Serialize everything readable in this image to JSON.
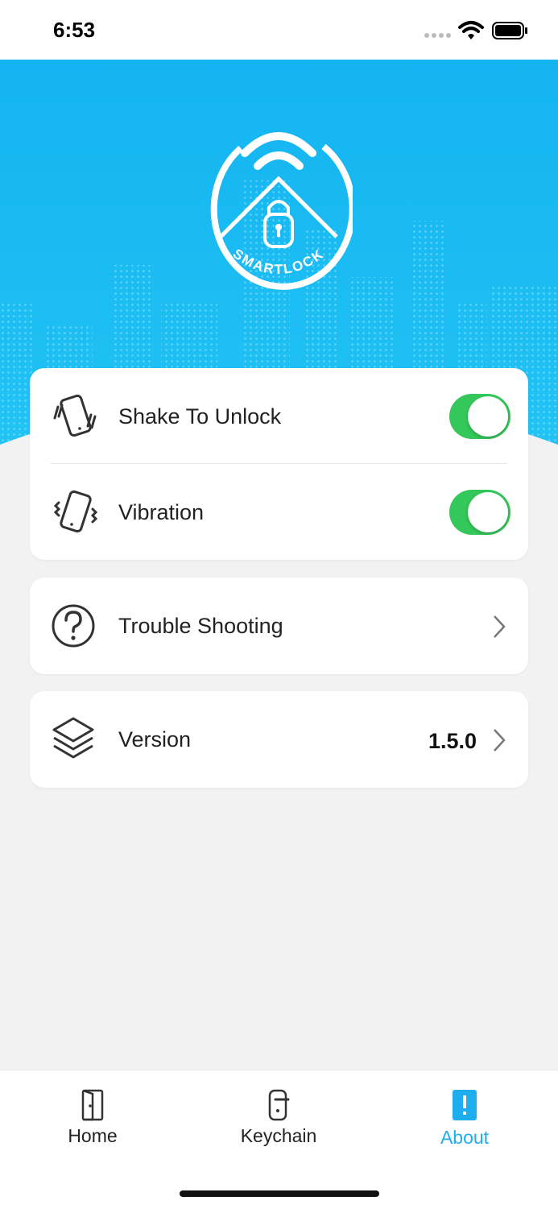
{
  "status_bar": {
    "time": "6:53"
  },
  "hero": {
    "logo_text": "SMARTLOCK"
  },
  "settings": [
    {
      "label": "Shake To Unlock",
      "icon": "shake-phone-icon",
      "enabled": true
    },
    {
      "label": "Vibration",
      "icon": "vibration-phone-icon",
      "enabled": true
    }
  ],
  "trouble": {
    "label": "Trouble Shooting",
    "icon": "question-circle-icon"
  },
  "version": {
    "label": "Version",
    "value": "1.5.0",
    "icon": "layers-icon"
  },
  "tabs": [
    {
      "label": "Home",
      "icon": "door-icon",
      "active": false
    },
    {
      "label": "Keychain",
      "icon": "door-handle-icon",
      "active": false
    },
    {
      "label": "About",
      "icon": "info-badge-icon",
      "active": true
    }
  ],
  "colors": {
    "accent": "#1eaef0",
    "toggle_on": "#34c759",
    "hero_blue": "#19b7f0"
  }
}
